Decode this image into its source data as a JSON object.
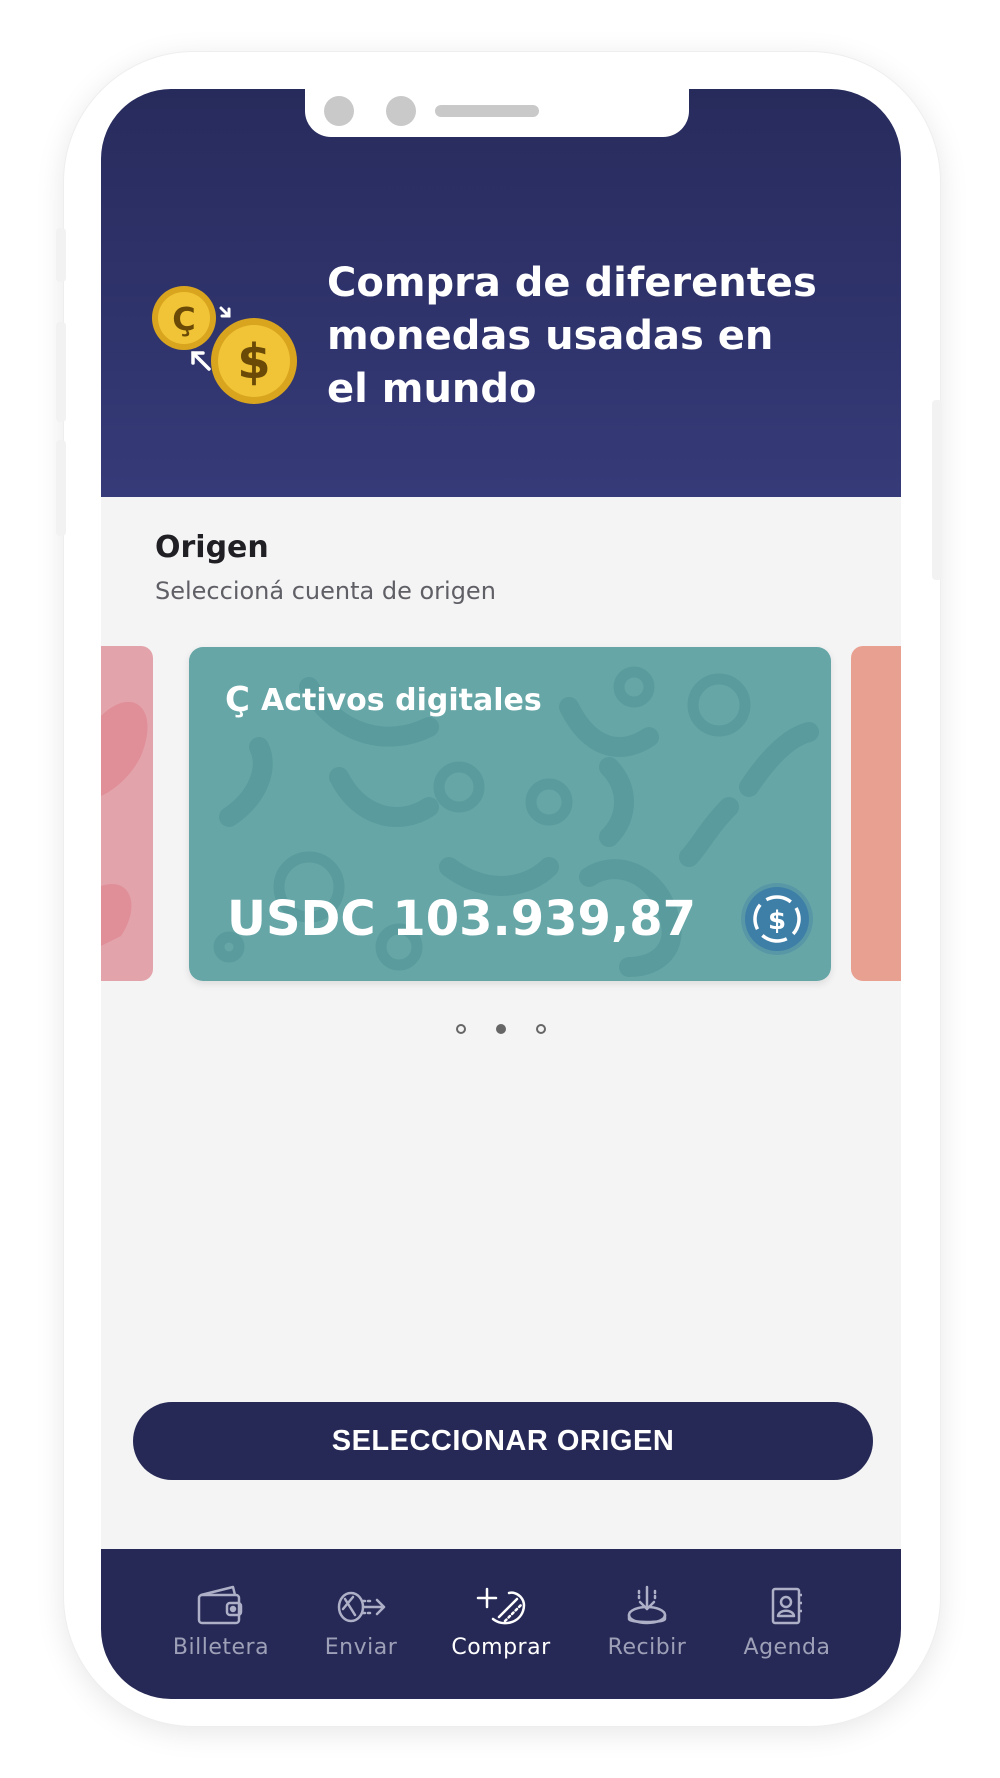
{
  "header": {
    "title": "Compra de diferentes\nmonedas usadas en\nel  mundo",
    "coin_icon_small": "Ç",
    "coin_icon_large": "$"
  },
  "origin": {
    "title": "Origen",
    "subtitle": "Seleccioná cuenta de origen"
  },
  "carousel": {
    "active_index": 1,
    "card": {
      "brand_icon": "Ç",
      "label": "Activos digitales",
      "balance": "USDC 103.939,87",
      "currency_icon": "usdc-icon"
    },
    "dot_count": 3
  },
  "cta": {
    "label": "SELECCIONAR ORIGEN"
  },
  "nav": {
    "items": [
      {
        "label": "Billetera",
        "icon": "wallet-icon"
      },
      {
        "label": "Enviar",
        "icon": "send-icon"
      },
      {
        "label": "Comprar",
        "icon": "buy-icon",
        "active": true
      },
      {
        "label": "Recibir",
        "icon": "receive-icon"
      },
      {
        "label": "Agenda",
        "icon": "contacts-icon"
      }
    ]
  },
  "colors": {
    "primary": "#262955",
    "card": "#66a6a7",
    "card_left": "#e3a3ab",
    "card_right": "#e8a090",
    "coin": "#e8b425"
  }
}
